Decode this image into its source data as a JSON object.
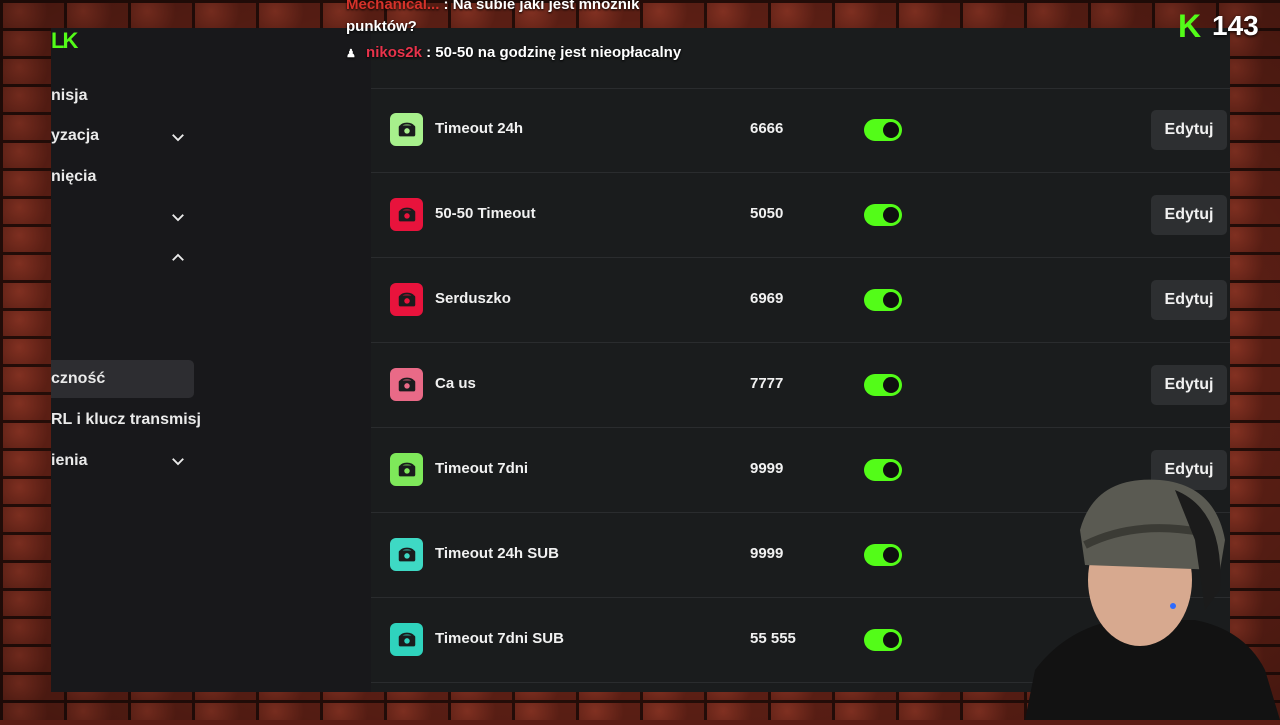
{
  "colors": {
    "accent": "#53fc18",
    "edit_bg": "#2d2f31",
    "toggle_on": "#53fc18"
  },
  "chat": {
    "line1_user": "Mechanical...",
    "line1_text": ": Na subie jaki jest mnożnik",
    "line1_cont": "punktów?",
    "line2_user": "nikos2k",
    "line2_text": ": 50-50 na godzinę jest nieopłacalny"
  },
  "counter": {
    "value": "143"
  },
  "sidebar": {
    "items": [
      {
        "label": "nisja"
      },
      {
        "label": "yzacja"
      },
      {
        "label": "nięcia"
      },
      {
        "label": ""
      },
      {
        "label": ""
      },
      {
        "label": "czność"
      },
      {
        "label": "RL i klucz transmisj"
      },
      {
        "label": "ienia"
      }
    ]
  },
  "rewards": {
    "edit_label": "Edytuj",
    "items": [
      {
        "name": "Timeout 24h",
        "cost": "6666",
        "enabled": true,
        "icon_color": "#a7f08c"
      },
      {
        "name": "50-50 Timeout",
        "cost": "5050",
        "enabled": true,
        "icon_color": "#e8133c"
      },
      {
        "name": "Serduszko",
        "cost": "6969",
        "enabled": true,
        "icon_color": "#e8133c"
      },
      {
        "name": "Ca us",
        "cost": "7777",
        "enabled": true,
        "icon_color": "#e96a87"
      },
      {
        "name": "Timeout 7dni",
        "cost": "9999",
        "enabled": true,
        "icon_color": "#7ee85a"
      },
      {
        "name": "Timeout 24h SUB",
        "cost": "9999",
        "enabled": true,
        "icon_color": "#3ed9c4"
      },
      {
        "name": "Timeout 7dni SUB",
        "cost": "55 555",
        "enabled": true,
        "icon_color": "#2fd3bd"
      }
    ]
  }
}
